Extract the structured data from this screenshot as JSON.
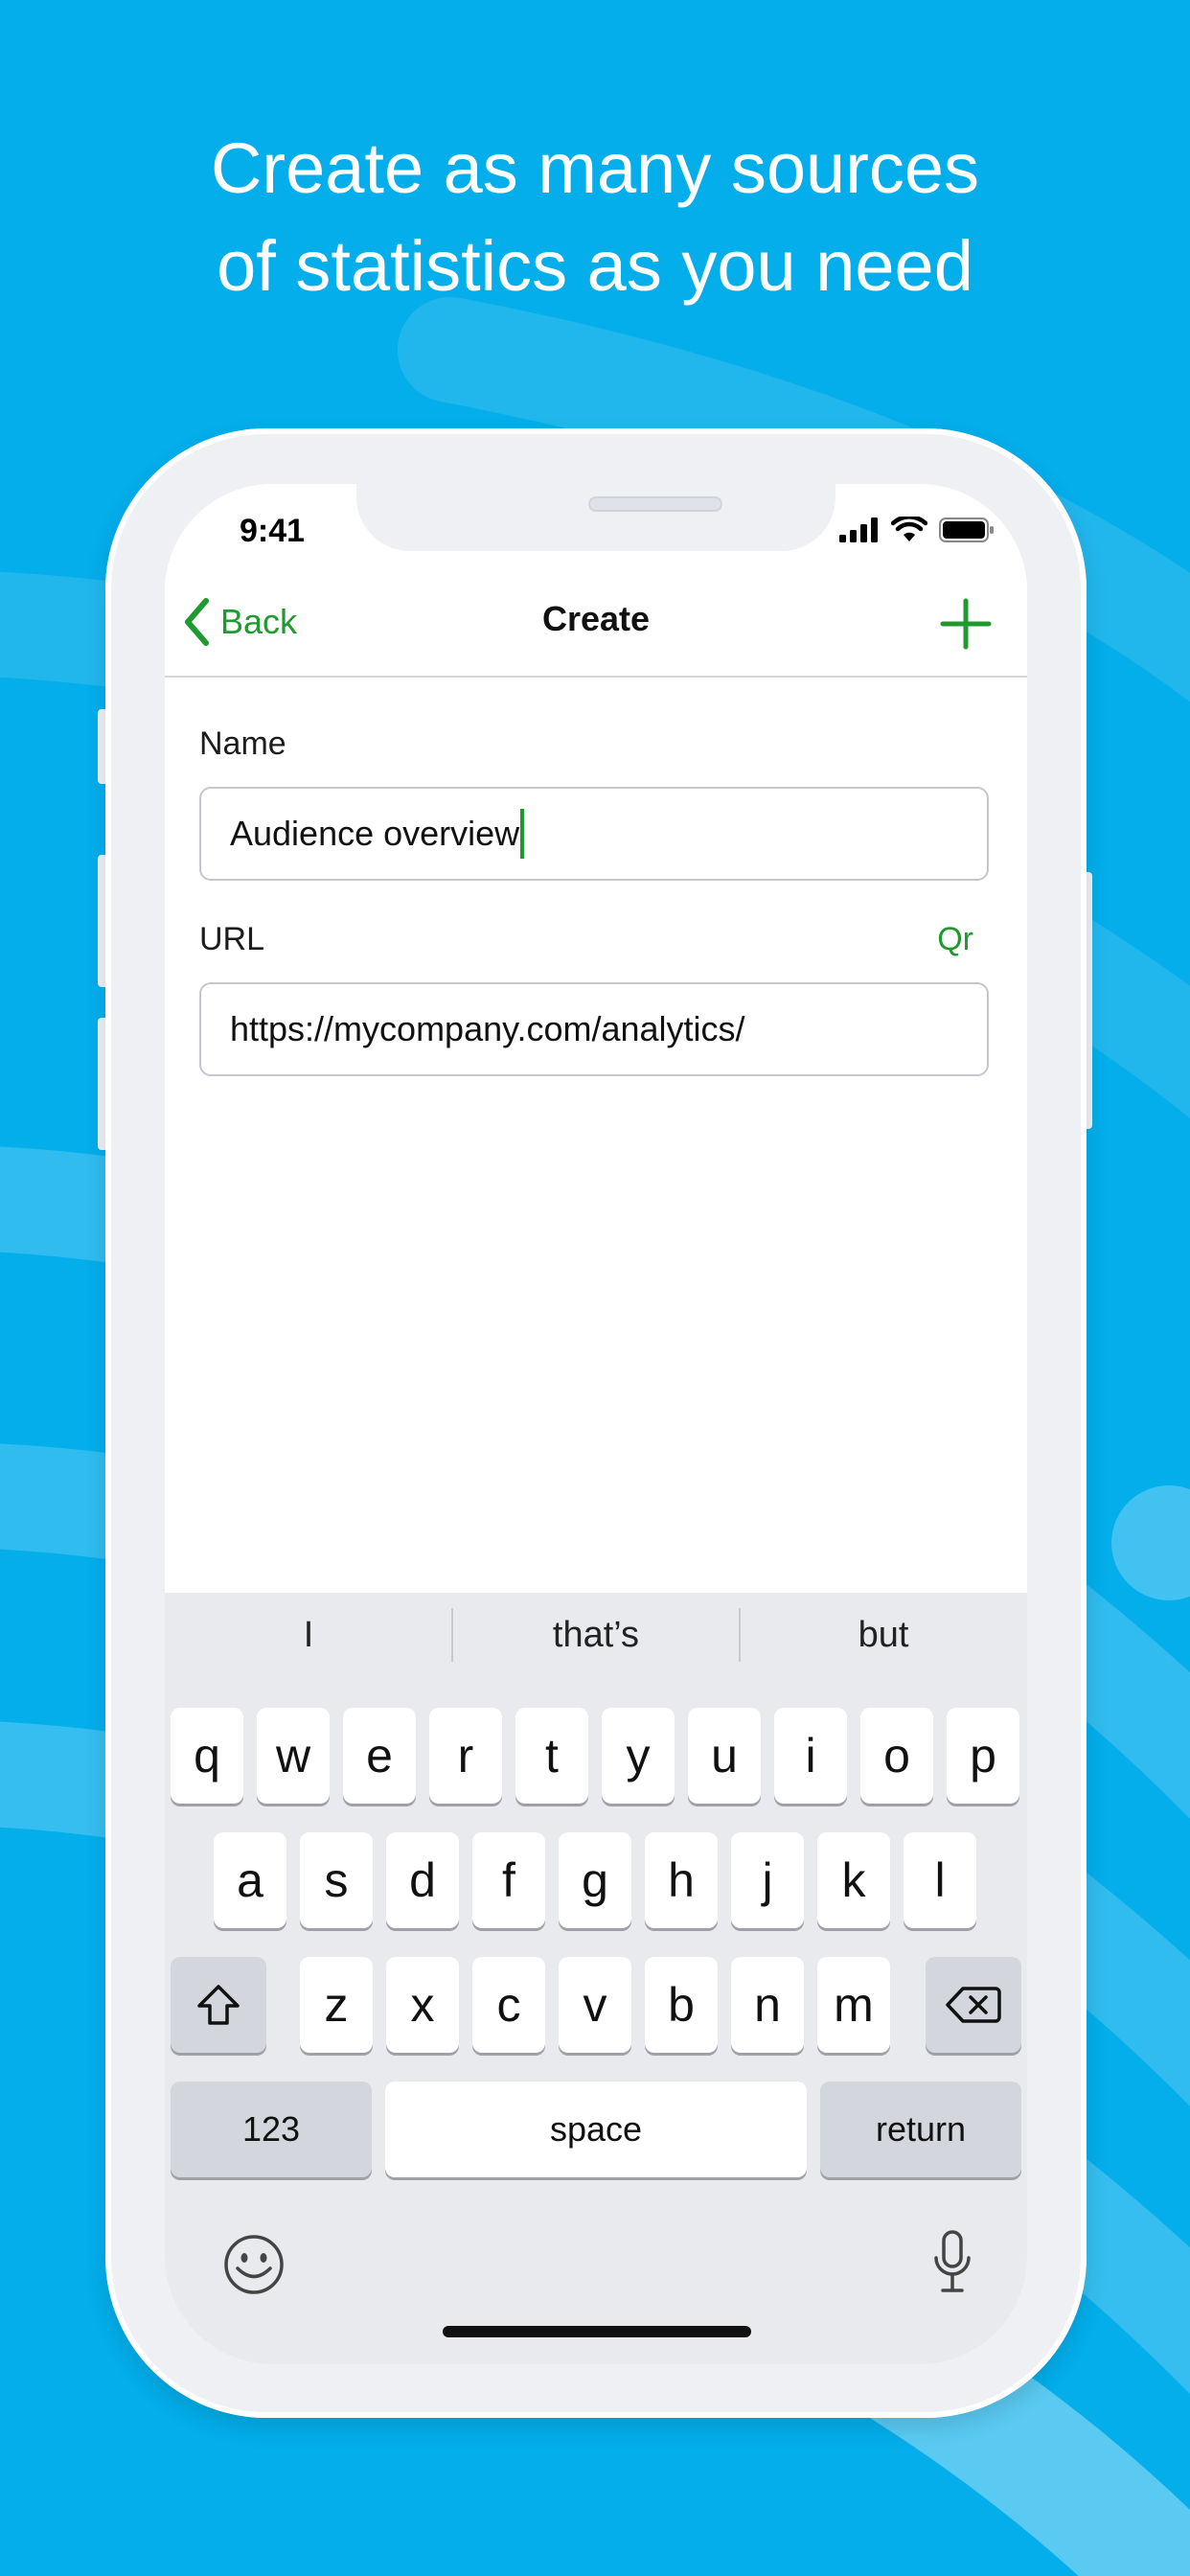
{
  "headline": {
    "line1": "Create as many sources",
    "line2": "of statistics as you need"
  },
  "status_bar": {
    "time": "9:41"
  },
  "nav": {
    "back_label": "Back",
    "title": "Create"
  },
  "form": {
    "name_label": "Name",
    "name_value": "Audience overview",
    "url_label": "URL",
    "qr_label": "Qr",
    "url_value": "https://mycompany.com/analytics/"
  },
  "keyboard": {
    "suggestions": [
      "I",
      "that’s",
      "but"
    ],
    "row1": [
      "q",
      "w",
      "e",
      "r",
      "t",
      "y",
      "u",
      "i",
      "o",
      "p"
    ],
    "row2": [
      "a",
      "s",
      "d",
      "f",
      "g",
      "h",
      "j",
      "k",
      "l"
    ],
    "row3": [
      "z",
      "x",
      "c",
      "v",
      "b",
      "n",
      "m"
    ],
    "numbers_label": "123",
    "space_label": "space",
    "return_label": "return"
  },
  "colors": {
    "background": "#03aeeb",
    "accent": "#1f9a2e"
  },
  "icons": [
    "chevron-left-icon",
    "plus-icon",
    "signal-icon",
    "wifi-icon",
    "battery-icon",
    "shift-icon",
    "delete-icon",
    "emoji-icon",
    "microphone-icon"
  ]
}
